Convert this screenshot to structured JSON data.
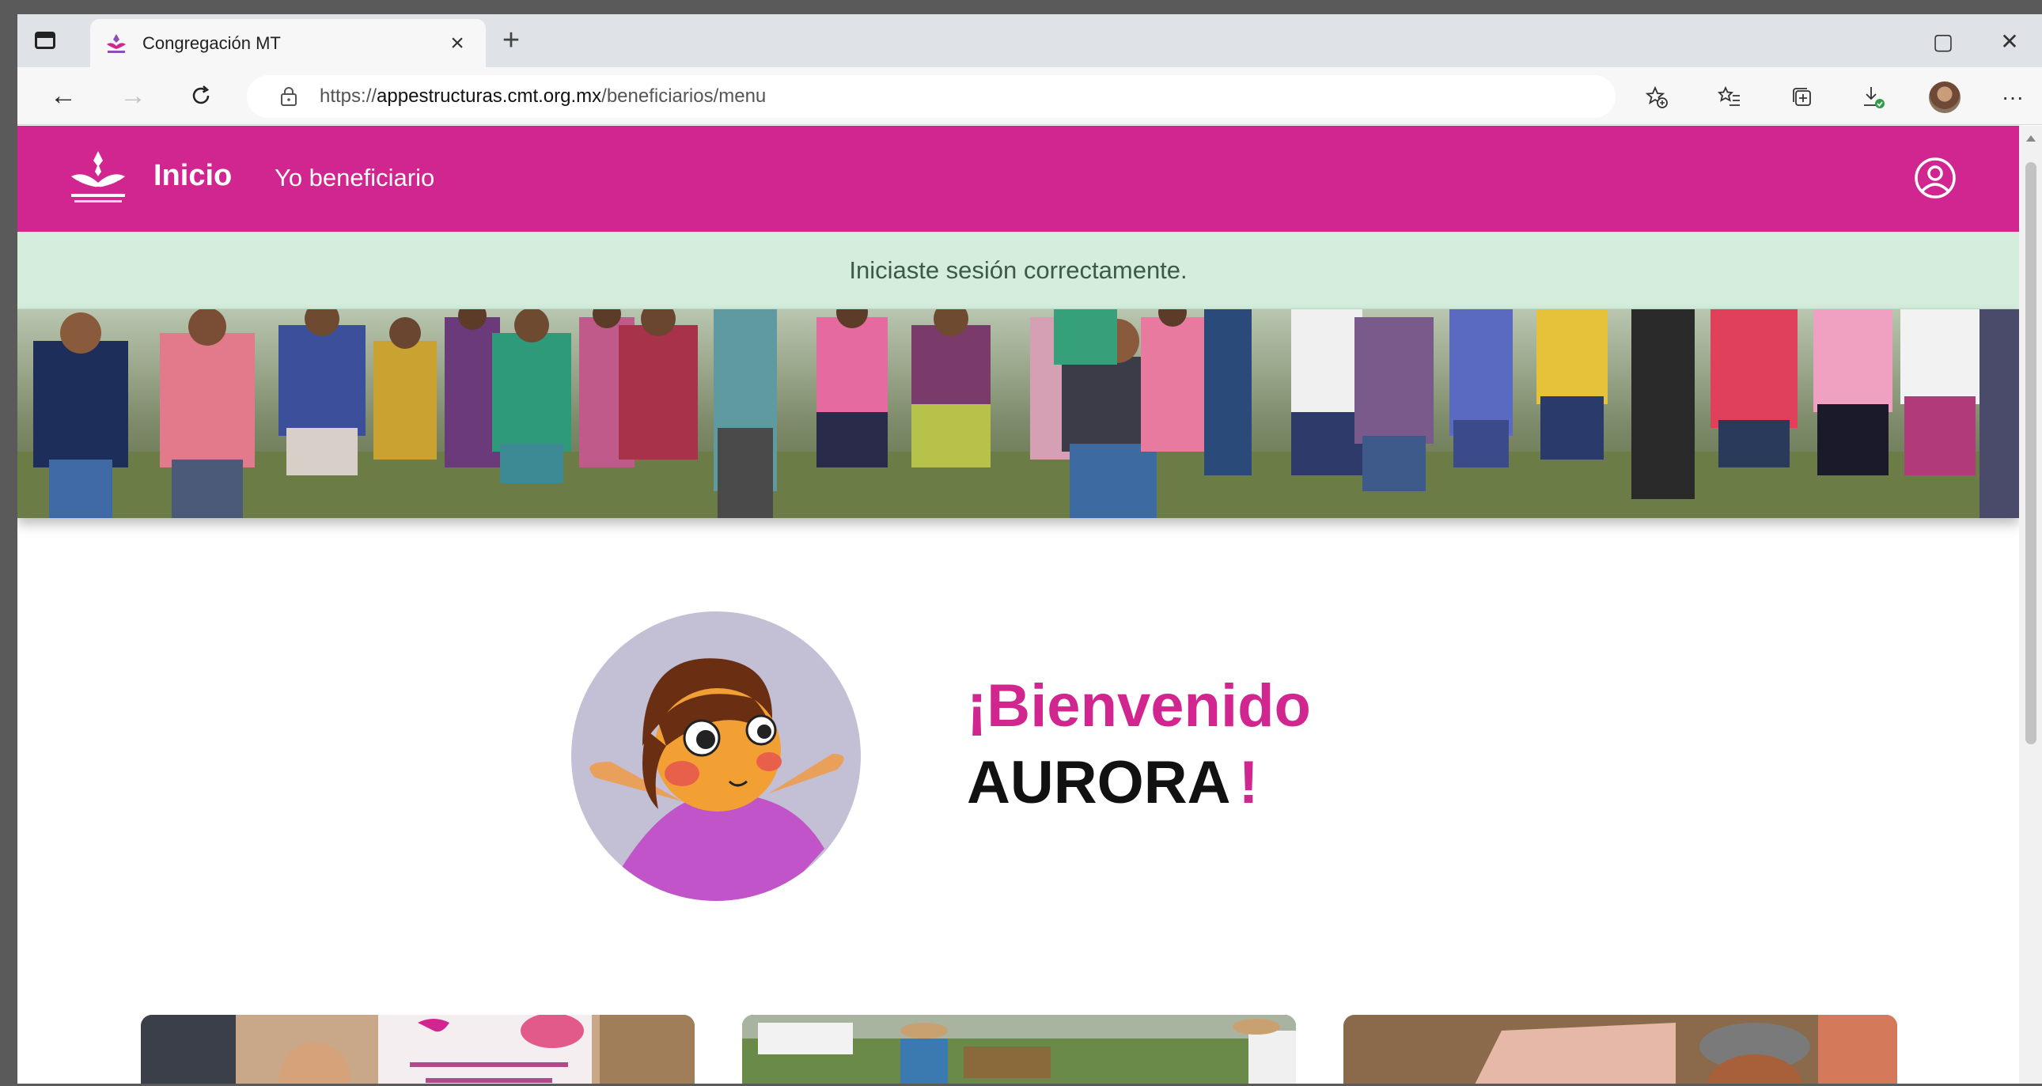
{
  "browser": {
    "tab_title": "Congregación MT",
    "tab_close": "×",
    "new_tab": "+",
    "url_scheme": "https://",
    "url_host": "appestructuras.cmt.org.mx",
    "url_path": "/beneficiarios/menu",
    "back": "←",
    "forward": "→",
    "refresh": "C",
    "more": "···",
    "restore": "▢",
    "close": "✕"
  },
  "app": {
    "brand_color": "#d1268f",
    "nav": {
      "home_label": "Inicio",
      "beneficiary_label": "Yo beneficiario"
    },
    "alert": {
      "message": "Iniciaste sesión correctamente."
    },
    "welcome": {
      "greeting": "¡Bienvenido",
      "name": "AURORA",
      "exclamation": "!"
    },
    "cards_count": 3
  }
}
